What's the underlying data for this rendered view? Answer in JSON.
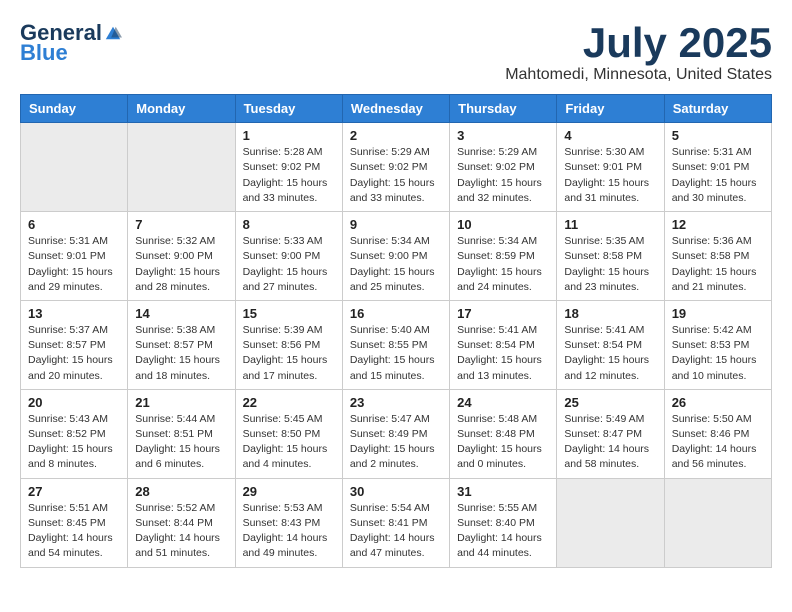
{
  "header": {
    "logo_general": "General",
    "logo_blue": "Blue",
    "month_title": "July 2025",
    "location": "Mahtomedi, Minnesota, United States"
  },
  "weekdays": [
    "Sunday",
    "Monday",
    "Tuesday",
    "Wednesday",
    "Thursday",
    "Friday",
    "Saturday"
  ],
  "weeks": [
    [
      {
        "day": "",
        "detail": ""
      },
      {
        "day": "",
        "detail": ""
      },
      {
        "day": "1",
        "detail": "Sunrise: 5:28 AM\nSunset: 9:02 PM\nDaylight: 15 hours and 33 minutes."
      },
      {
        "day": "2",
        "detail": "Sunrise: 5:29 AM\nSunset: 9:02 PM\nDaylight: 15 hours and 33 minutes."
      },
      {
        "day": "3",
        "detail": "Sunrise: 5:29 AM\nSunset: 9:02 PM\nDaylight: 15 hours and 32 minutes."
      },
      {
        "day": "4",
        "detail": "Sunrise: 5:30 AM\nSunset: 9:01 PM\nDaylight: 15 hours and 31 minutes."
      },
      {
        "day": "5",
        "detail": "Sunrise: 5:31 AM\nSunset: 9:01 PM\nDaylight: 15 hours and 30 minutes."
      }
    ],
    [
      {
        "day": "6",
        "detail": "Sunrise: 5:31 AM\nSunset: 9:01 PM\nDaylight: 15 hours and 29 minutes."
      },
      {
        "day": "7",
        "detail": "Sunrise: 5:32 AM\nSunset: 9:00 PM\nDaylight: 15 hours and 28 minutes."
      },
      {
        "day": "8",
        "detail": "Sunrise: 5:33 AM\nSunset: 9:00 PM\nDaylight: 15 hours and 27 minutes."
      },
      {
        "day": "9",
        "detail": "Sunrise: 5:34 AM\nSunset: 9:00 PM\nDaylight: 15 hours and 25 minutes."
      },
      {
        "day": "10",
        "detail": "Sunrise: 5:34 AM\nSunset: 8:59 PM\nDaylight: 15 hours and 24 minutes."
      },
      {
        "day": "11",
        "detail": "Sunrise: 5:35 AM\nSunset: 8:58 PM\nDaylight: 15 hours and 23 minutes."
      },
      {
        "day": "12",
        "detail": "Sunrise: 5:36 AM\nSunset: 8:58 PM\nDaylight: 15 hours and 21 minutes."
      }
    ],
    [
      {
        "day": "13",
        "detail": "Sunrise: 5:37 AM\nSunset: 8:57 PM\nDaylight: 15 hours and 20 minutes."
      },
      {
        "day": "14",
        "detail": "Sunrise: 5:38 AM\nSunset: 8:57 PM\nDaylight: 15 hours and 18 minutes."
      },
      {
        "day": "15",
        "detail": "Sunrise: 5:39 AM\nSunset: 8:56 PM\nDaylight: 15 hours and 17 minutes."
      },
      {
        "day": "16",
        "detail": "Sunrise: 5:40 AM\nSunset: 8:55 PM\nDaylight: 15 hours and 15 minutes."
      },
      {
        "day": "17",
        "detail": "Sunrise: 5:41 AM\nSunset: 8:54 PM\nDaylight: 15 hours and 13 minutes."
      },
      {
        "day": "18",
        "detail": "Sunrise: 5:41 AM\nSunset: 8:54 PM\nDaylight: 15 hours and 12 minutes."
      },
      {
        "day": "19",
        "detail": "Sunrise: 5:42 AM\nSunset: 8:53 PM\nDaylight: 15 hours and 10 minutes."
      }
    ],
    [
      {
        "day": "20",
        "detail": "Sunrise: 5:43 AM\nSunset: 8:52 PM\nDaylight: 15 hours and 8 minutes."
      },
      {
        "day": "21",
        "detail": "Sunrise: 5:44 AM\nSunset: 8:51 PM\nDaylight: 15 hours and 6 minutes."
      },
      {
        "day": "22",
        "detail": "Sunrise: 5:45 AM\nSunset: 8:50 PM\nDaylight: 15 hours and 4 minutes."
      },
      {
        "day": "23",
        "detail": "Sunrise: 5:47 AM\nSunset: 8:49 PM\nDaylight: 15 hours and 2 minutes."
      },
      {
        "day": "24",
        "detail": "Sunrise: 5:48 AM\nSunset: 8:48 PM\nDaylight: 15 hours and 0 minutes."
      },
      {
        "day": "25",
        "detail": "Sunrise: 5:49 AM\nSunset: 8:47 PM\nDaylight: 14 hours and 58 minutes."
      },
      {
        "day": "26",
        "detail": "Sunrise: 5:50 AM\nSunset: 8:46 PM\nDaylight: 14 hours and 56 minutes."
      }
    ],
    [
      {
        "day": "27",
        "detail": "Sunrise: 5:51 AM\nSunset: 8:45 PM\nDaylight: 14 hours and 54 minutes."
      },
      {
        "day": "28",
        "detail": "Sunrise: 5:52 AM\nSunset: 8:44 PM\nDaylight: 14 hours and 51 minutes."
      },
      {
        "day": "29",
        "detail": "Sunrise: 5:53 AM\nSunset: 8:43 PM\nDaylight: 14 hours and 49 minutes."
      },
      {
        "day": "30",
        "detail": "Sunrise: 5:54 AM\nSunset: 8:41 PM\nDaylight: 14 hours and 47 minutes."
      },
      {
        "day": "31",
        "detail": "Sunrise: 5:55 AM\nSunset: 8:40 PM\nDaylight: 14 hours and 44 minutes."
      },
      {
        "day": "",
        "detail": ""
      },
      {
        "day": "",
        "detail": ""
      }
    ]
  ]
}
